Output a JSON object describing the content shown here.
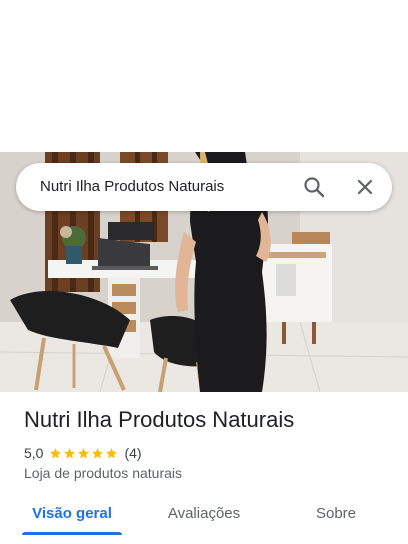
{
  "search": {
    "query": "Nutri Ilha Produtos Naturais"
  },
  "place": {
    "name": "Nutri Ilha Produtos Naturais",
    "rating": "5,0",
    "stars": 5,
    "review_count": "(4)",
    "category": "Loja de produtos naturais"
  },
  "tabs": [
    {
      "label": "Visão geral",
      "active": true
    },
    {
      "label": "Avaliações",
      "active": false
    },
    {
      "label": "Sobre",
      "active": false
    }
  ],
  "colors": {
    "accent": "#1a73e8",
    "star": "#fbbc04"
  },
  "icons": [
    "search-icon",
    "close-icon",
    "star-icon"
  ]
}
